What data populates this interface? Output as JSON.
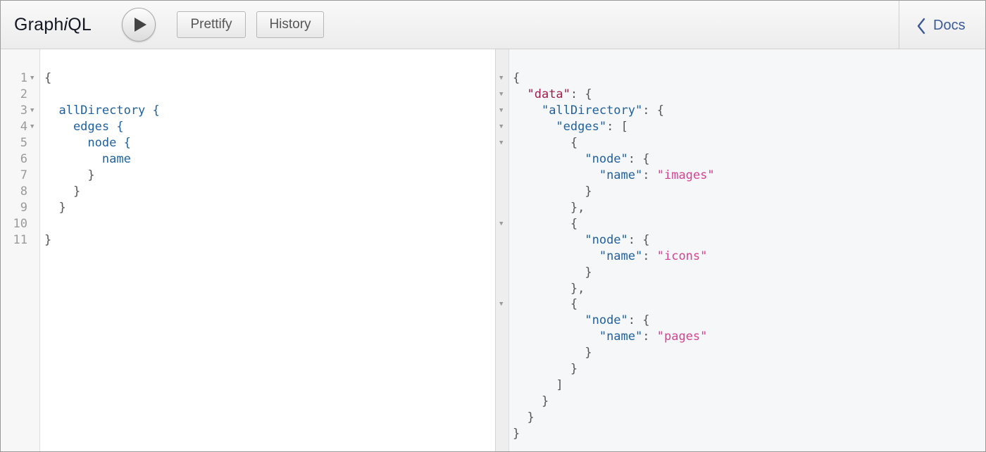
{
  "app": {
    "title_prefix": "Graph",
    "title_italic": "i",
    "title_suffix": "QL"
  },
  "toolbar": {
    "execute_label": "Execute query",
    "prettify_label": "Prettify",
    "history_label": "History",
    "docs_label": "Docs"
  },
  "editor": {
    "line_numbers": [
      "1",
      "2",
      "3",
      "4",
      "5",
      "6",
      "7",
      "8",
      "9",
      "10",
      "11"
    ],
    "lines": [
      "{",
      "",
      "  allDirectory {",
      "    edges {",
      "      node {",
      "        name",
      "      }",
      "    }",
      "  }",
      "",
      "}"
    ]
  },
  "result": {
    "lines": [
      "{",
      "  \"data\": {",
      "    \"allDirectory\": {",
      "      \"edges\": [",
      "        {",
      "          \"node\": {",
      "            \"name\": \"images\"",
      "          }",
      "        },",
      "        {",
      "          \"node\": {",
      "            \"name\": \"icons\"",
      "          }",
      "        },",
      "        {",
      "          \"node\": {",
      "            \"name\": \"pages\"",
      "          }",
      "        }",
      "      ]",
      "    }",
      "  }",
      "}"
    ]
  },
  "colors": {
    "field": "#1f61a0",
    "data_key": "#a11a4d",
    "string": "#d64292",
    "docs_link": "#3b5998"
  }
}
